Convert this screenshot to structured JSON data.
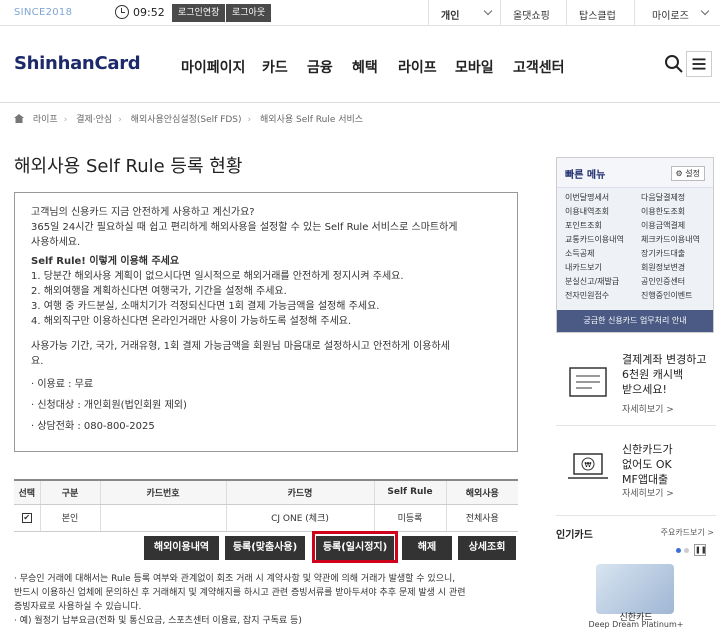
{
  "topbar": {
    "since": "SINCE2018",
    "time": "09:52",
    "extend_label": "로그인연장",
    "logout_label": "로그아웃",
    "personal_label": "개인",
    "shopping_label": "올댓쇼핑",
    "tops_label": "탑스클럽",
    "mylife_label": "마이로즈"
  },
  "header": {
    "logo": "ShinhanCard",
    "nav": [
      "마이페이지",
      "카드",
      "금융",
      "혜택",
      "라이프",
      "모바일",
      "고객센터"
    ]
  },
  "breadcrumb": [
    "라이프",
    "결제·안심",
    "해외사용안심설정(Self FDS)",
    "해외사용 Self Rule 서비스"
  ],
  "page_title": "해외사용 Self Rule 등록 현황",
  "info": {
    "lines1": [
      "고객님의 신용카드 지금 안전하게 사용하고 계신가요?",
      "365일 24시간 필요하실 때 쉽고 편리하게 해외사용을 설정할 수 있는 Self Rule 서비스로 스마트하게",
      "사용하세요."
    ],
    "heading": "Self Rule! 이렇게 이용해 주세요",
    "list": [
      "1. 당분간 해외사용 계획이 없으시다면 일시적으로 해외거래를 안전하게 정지시켜 주세요.",
      "2. 해외여행을 계획하신다면 여행국가, 기간을 설정해 주세요.",
      "3. 여행 중 카드분실, 소매치기가 걱정되신다면 1회 결제 가능금액을 설정해 주세요.",
      "4. 해외직구만 이용하신다면 온라인거래만 사용이 가능하도록 설정해 주세요."
    ],
    "lines2": [
      "사용가능 기간, 국가, 거래유형, 1회 결제 가능금액을 회원님 마음대로 설정하시고 안전하게 이용하세",
      "요."
    ],
    "fee": "· 이용료 : 무료",
    "target": "· 신청대상 : 개인회원(법인회원 제외)",
    "phone": "· 상담전화 : 080-800-2025"
  },
  "table": {
    "headers": [
      "선택",
      "구분",
      "카드번호",
      "카드명",
      "Self Rule",
      "해외사용"
    ],
    "row": {
      "type": "본인",
      "card_no": "",
      "card_name": "CJ ONE (체크)",
      "self_rule": "미등록",
      "overseas": "전체사용"
    }
  },
  "actions": [
    "해외이용내역",
    "등록(맞춤사용)",
    "등록(일시정지)",
    "해제",
    "상세조회"
  ],
  "notes": [
    "· 무승인 거래에 대해서는 Rule 등록 여부와 관계없이 회조 거래 시 계약사항 및 약관에 의해 거래가 발생할 수 있으니,",
    "  반드시 이용하신 업체에 문의하신 후 거래해지 및 계약해지를 하시고 관련 증빙서류를 받아두셔야 추후 문제 발생 시 관련",
    "  증빙자료로 사용하실 수 있습니다.",
    "· 예) 월정기 납부요금(전화 및 통신요금, 스포츠센터 이용료, 잡지 구독료 등)"
  ],
  "quickmenu": {
    "title": "빠른 메뉴",
    "settings": "설정",
    "items": [
      "이번달명세서",
      "다음달결제정",
      "이용내역조회",
      "이용한도조회",
      "포인트조회",
      "이용금액결제",
      "교통카드이용내역",
      "체크카드이용내역",
      "소득공제",
      "장기카드대출",
      "내카드보기",
      "회원정보변경",
      "분실신고/재발급",
      "공인인증센터",
      "전자민원접수",
      "진행중인이벤트"
    ],
    "footer": "궁금한 신용카드 업무처리 안내"
  },
  "promos": [
    {
      "lines": [
        "결제계좌 변경하고",
        "6천원 캐시백",
        "받으세요!"
      ],
      "more": "자세히보기 >"
    },
    {
      "lines": [
        "신한카드가",
        "없어도 OK",
        "MF앱대출"
      ],
      "more": "자세히보기 >"
    }
  ],
  "popular": {
    "title": "인기카드",
    "more": "주요카드보기 >",
    "card_name": "신한카드",
    "card_sub": "Deep Dream Platinum+"
  }
}
